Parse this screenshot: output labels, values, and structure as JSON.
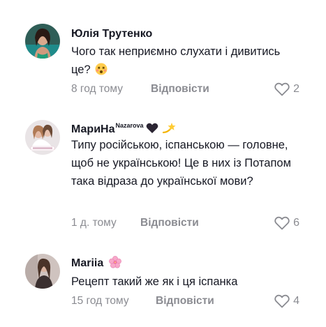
{
  "comments": [
    {
      "author": "Юлія Трутенко",
      "author_sup": "",
      "text": "Чого так неприємно слухати і дивитись це?",
      "time": "8 год тому",
      "reply_label": "Відповісти",
      "likes": "2",
      "emojis": [
        "dizzy-face-icon"
      ]
    },
    {
      "author": "МариНа",
      "author_sup": "Nazarova",
      "text": "Типу російською, іспанською — головне, щоб не українською! Це в них із Потапом така відраза до української мови?",
      "time": "1 д. тому",
      "reply_label": "Відповісти",
      "likes": "6",
      "emojis": [
        "black-heart-icon",
        "dizzy-star-icon"
      ]
    },
    {
      "author": "Mariia",
      "author_sup": "",
      "text": "Рецепт такий же як і ця іспанка",
      "time": "15 год тому",
      "reply_label": "Відповісти",
      "likes": "4",
      "emojis": [
        "cherry-blossom-icon"
      ]
    }
  ],
  "colors": {
    "text": "#161823",
    "muted": "#8a8b91"
  }
}
